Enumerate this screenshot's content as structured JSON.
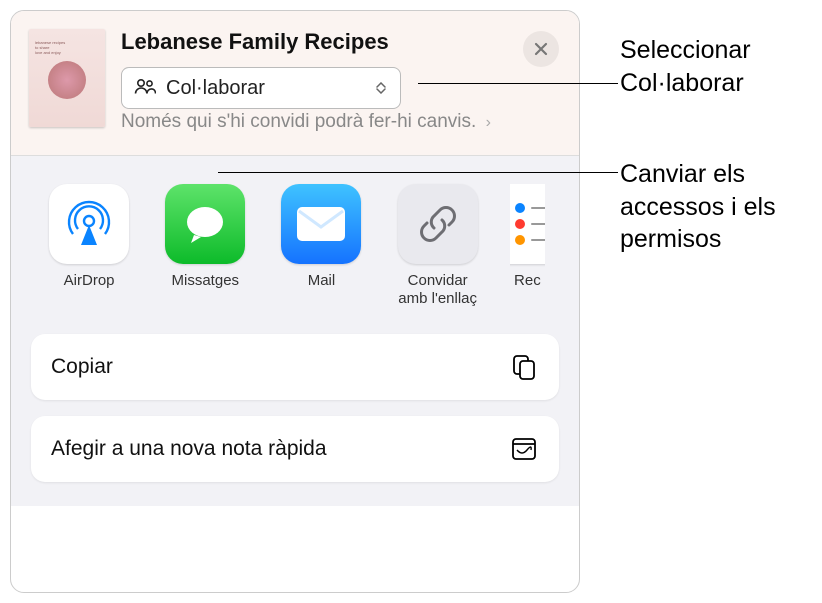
{
  "header": {
    "title": "Lebanese Family Recipes",
    "dropdown_label": "Col·laborar",
    "hint_text": "Només qui s'hi convidi podrà fer-hi canvis.",
    "icon_names": {
      "close": "close-icon",
      "people": "people-icon",
      "chevron": "chevron-right-icon",
      "updown": "updown-arrows-icon"
    }
  },
  "apps": [
    {
      "label": "AirDrop",
      "icon": "airdrop"
    },
    {
      "label": "Missatges",
      "icon": "messages"
    },
    {
      "label": "Mail",
      "icon": "mail"
    },
    {
      "label": "Convidar amb l'enllaç",
      "icon": "link"
    },
    {
      "label": "Rec",
      "icon": "reminders"
    }
  ],
  "actions": [
    {
      "label": "Copiar",
      "icon": "copy"
    },
    {
      "label": "Afegir a una nova nota ràpida",
      "icon": "quicknote"
    }
  ],
  "annotations": {
    "a1": "Seleccionar Col·laborar",
    "a2": "Canviar els accessos i els permisos"
  }
}
